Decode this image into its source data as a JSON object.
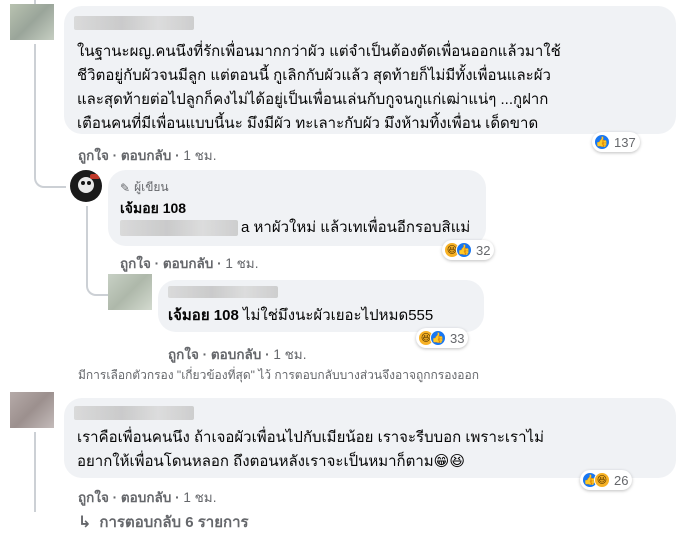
{
  "comments": [
    {
      "text_lines": [
        "ในฐานะผญ.คนนึงที่รักเพื่อนมากกว่าผัว แต่จำเป็นต้องตัดเพื่อนออกแล้วมาใช้",
        "ชีวิตอยู่กับผัวจนมีลูก แต่ตอนนี้ กูเลิกกับผัวแล้ว สุดท้ายก็ไม่มีทั้งเพื่อนและผัว",
        "และสุดท้ายต่อไปลูกก็คงไม่ได้อยู่เป็นเพื่อนเล่นกับกูจนกูแก่เฒ่าแน่ๆ ...กูฝาก",
        "เตือนคนที่มีเพื่อนแบบนี้นะ มึงมีผัว ทะเลาะกับผัว มึงห้ามทิ้งเพื่อน เด็ดขาด"
      ],
      "like_label": "ถูกใจ",
      "reply_label": "ตอบกลับ",
      "time": "1 ชม.",
      "reaction_count": "137"
    },
    {
      "author_badge": "ผู้เขียน",
      "author": "เจ้มอย 108",
      "text": "a หาผัวใหม่ แล้วเทเพื่อนอีกรอบสิแม่",
      "like_label": "ถูกใจ",
      "reply_label": "ตอบกลับ",
      "time": "1 ชม.",
      "reaction_count": "32"
    },
    {
      "mention": "เจ้มอย 108",
      "text": " ไม่ใช่มึงนะผัวเยอะไปหมด555",
      "like_label": "ถูกใจ",
      "reply_label": "ตอบกลับ",
      "time": "1 ชม.",
      "reaction_count": "33"
    },
    {
      "text_lines": [
        "เราคือเพื่อนคนนึง ถ้าเจอผัวเพื่อนไปกับเมียน้อย เราจะรีบบอก เพราะเราไม่",
        "อยากให้เพื่อนโดนหลอก ถึงตอนหลังเราจะเป็นหมาก็ตาม😁😆"
      ],
      "like_label": "ถูกใจ",
      "reply_label": "ตอบกลับ",
      "time": "1 ชม.",
      "reaction_count": "26"
    }
  ],
  "filter_note": "มีการเลือกตัวกรอง \"เกี่ยวข้องที่สุด\" ไว้ การตอบกลับบางส่วนจึงอาจถูกกรองออก",
  "more_replies": "การตอบกลับ 6 รายการ",
  "separator": "·",
  "icons": {
    "like": "like-icon",
    "haha": "haha-icon",
    "pencil": "pencil-icon",
    "reply_arrow": "reply-arrow-icon"
  }
}
